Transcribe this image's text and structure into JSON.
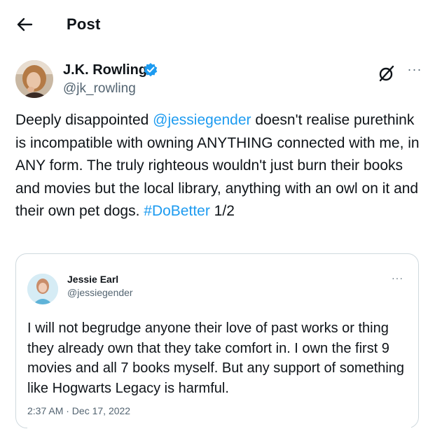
{
  "header": {
    "title": "Post",
    "back_icon": "arrow-left-icon"
  },
  "author": {
    "name": "J.K. Rowling",
    "handle": "@jk_rowling",
    "verified": true,
    "verified_color": "#1d9bf0"
  },
  "actions": {
    "grok_icon": "grok-icon",
    "more_icon": "more-horizontal-icon",
    "more_label": "···"
  },
  "post": {
    "text_1": "Deeply disappointed ",
    "mention": "@jessiegender",
    "text_2": " doesn't realise purethink is incompatible with owning ANYTHING connected with me, in ANY form. The truly righteous wouldn't just burn their books and movies but the local library, anything with an owl on it and their own pet dogs. ",
    "hashtag": "#DoBetter",
    "text_3": " 1/2",
    "link_color": "#1d9bf0"
  },
  "quoted": {
    "name": "Jessie Earl",
    "handle": "@jessiegender",
    "more_label": "···",
    "text": "I will not begrudge anyone their love of past works or thing they already own that they take comfort in. I own the first 9 movies and all 7 books myself. But any support of something like Hogwarts Legacy is harmful.",
    "timestamp": "2:37 AM · Dec 17, 2022"
  }
}
